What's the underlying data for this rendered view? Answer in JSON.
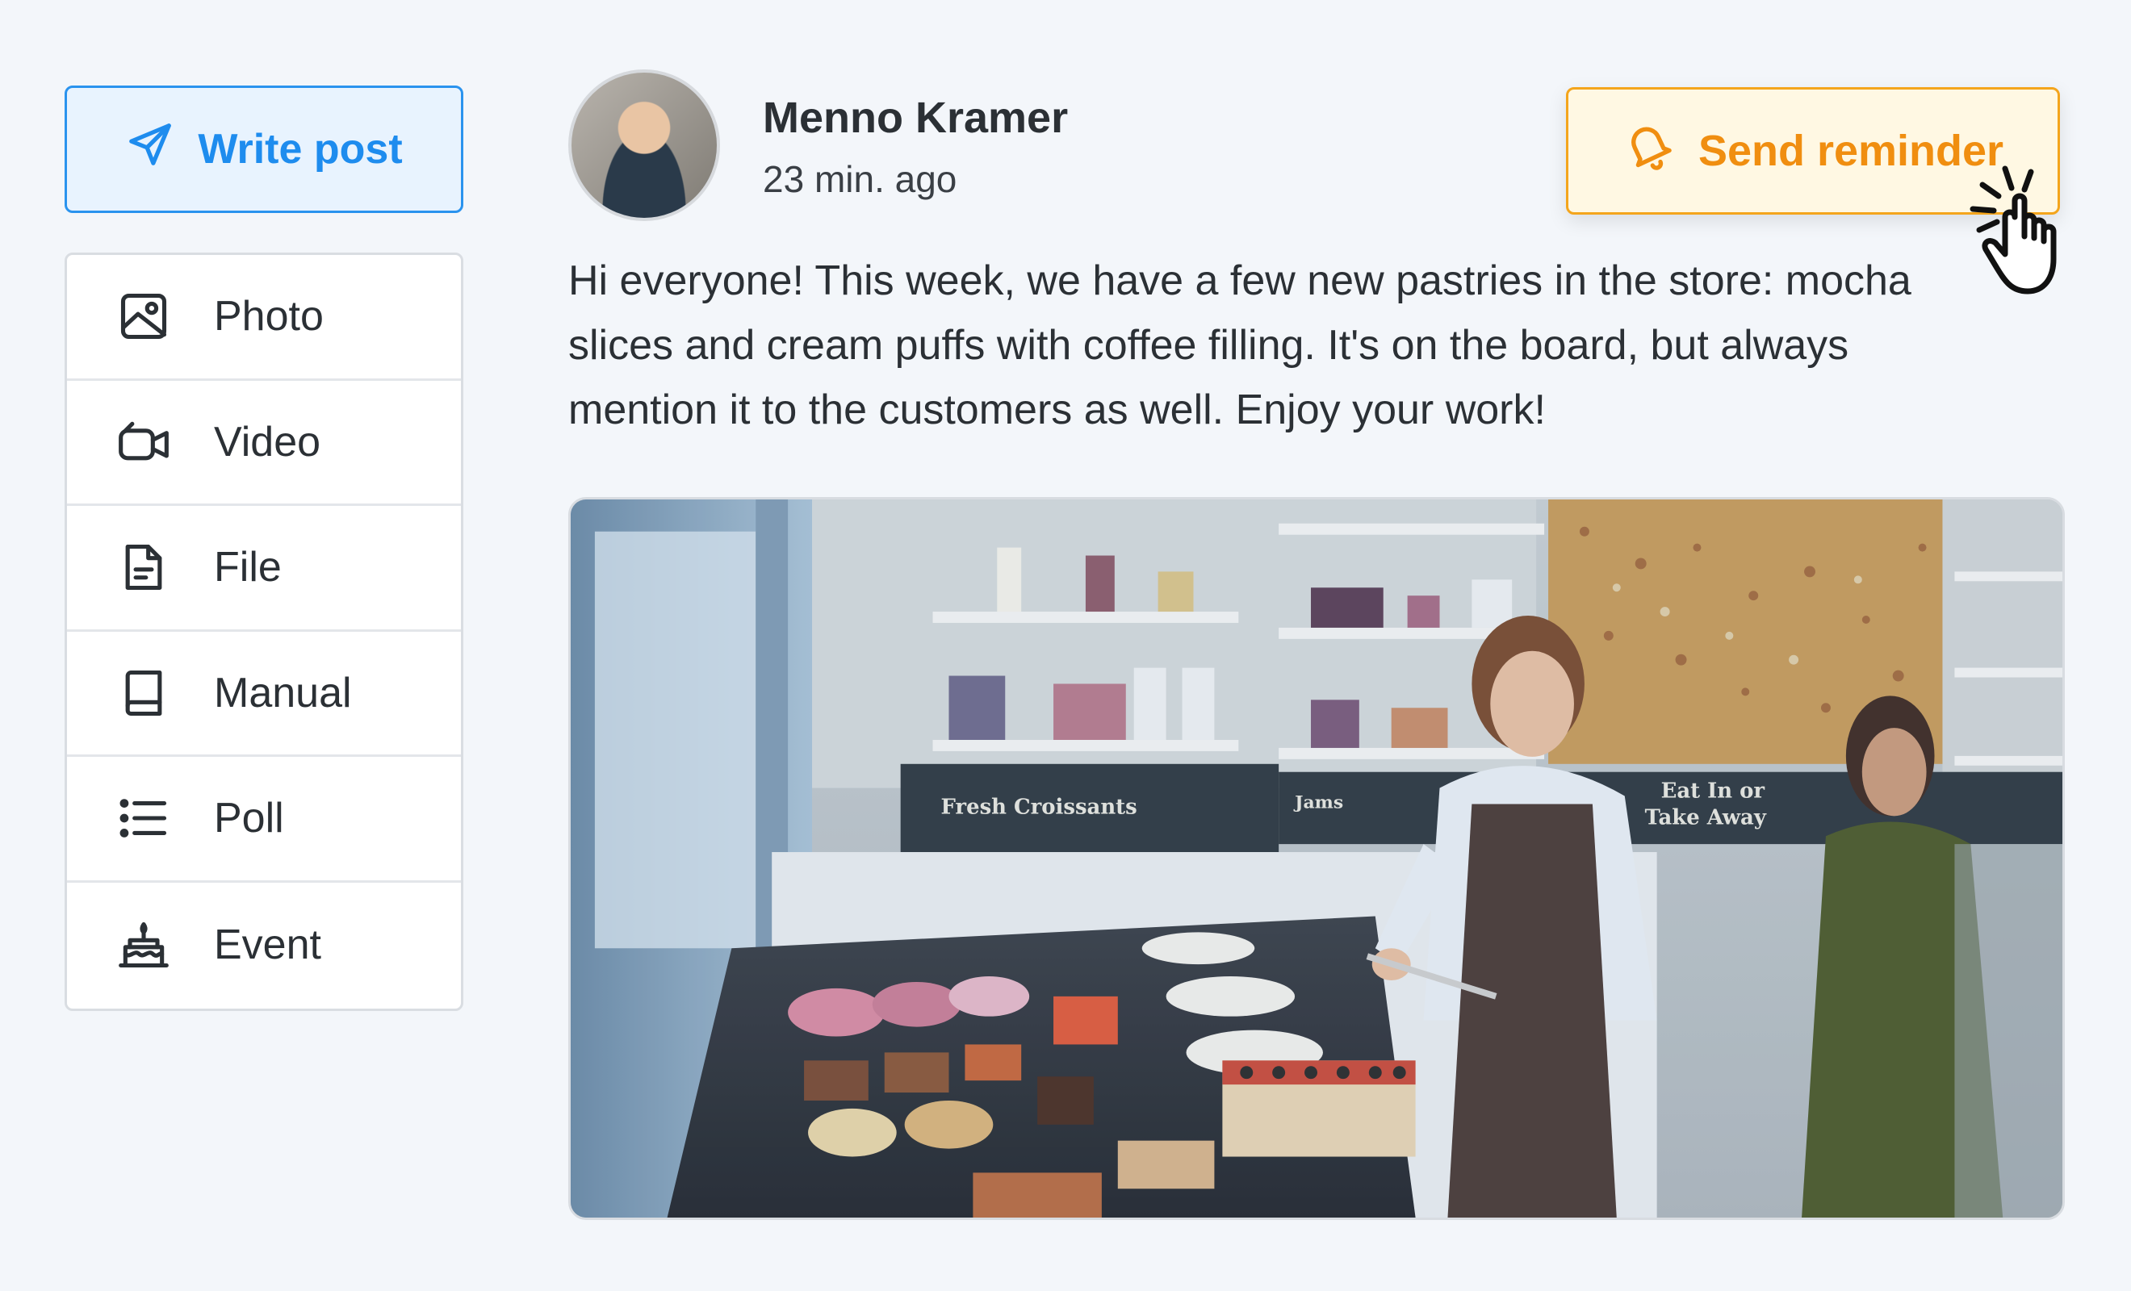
{
  "sidebar": {
    "write_post_label": "Write post",
    "items": [
      {
        "label": "Photo",
        "icon": "image-icon"
      },
      {
        "label": "Video",
        "icon": "video-camera-icon"
      },
      {
        "label": "File",
        "icon": "file-icon"
      },
      {
        "label": "Manual",
        "icon": "book-icon"
      },
      {
        "label": "Poll",
        "icon": "list-icon"
      },
      {
        "label": "Event",
        "icon": "cake-icon"
      }
    ]
  },
  "post": {
    "author": "Menno Kramer",
    "time": "23 min. ago",
    "reminder_label": "Send reminder",
    "text_lines": [
      "Hi everyone! This week, we have a few new pastries in the store: mocha",
      "slices and cream puffs with coffee filling. It's on the board, but always",
      "mention it to the customers as well. Enjoy your work!"
    ]
  },
  "photo_signs": {
    "croissants": "Fresh Croissants",
    "jams": "Jams",
    "eat_in": "Eat In or",
    "take_away": "Take Away"
  },
  "colors": {
    "accent_blue": "#1e8cee",
    "accent_orange": "#f08e10",
    "background": "#f3f6fa"
  }
}
